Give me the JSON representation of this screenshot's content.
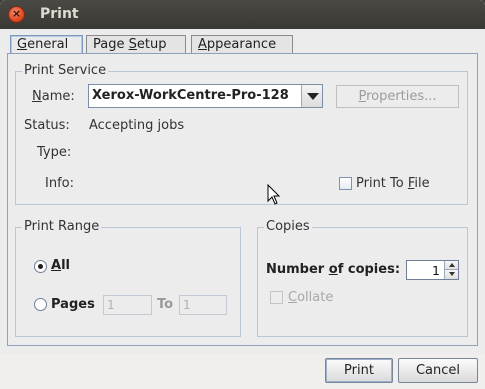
{
  "window": {
    "title": "Print"
  },
  "tabs": [
    {
      "label_underlined": "G",
      "label_rest": "eneral",
      "active": true
    },
    {
      "label_pre": "Page ",
      "label_underlined": "S",
      "label_rest": "etup",
      "active": false
    },
    {
      "label_underlined": "A",
      "label_rest": "ppearance",
      "active": false
    }
  ],
  "print_service": {
    "title": "Print Service",
    "name_label_u": "N",
    "name_label_rest": "ame:",
    "selected_printer": "Xerox-WorkCentre-Pro-128",
    "properties_u": "P",
    "properties_rest": "roperties...",
    "status_label": "Status:",
    "status_value": "Accepting jobs",
    "type_label": "Type:",
    "type_value": "",
    "info_label": "Info:",
    "info_value": "",
    "print_to_file_pre": "Print To ",
    "print_to_file_u": "F",
    "print_to_file_rest": "ile",
    "print_to_file_checked": false
  },
  "print_range": {
    "title": "Print Range",
    "all_u": "A",
    "all_rest": "ll",
    "all_selected": true,
    "pages_pre": "Pa",
    "pages_u": "g",
    "pages_rest": "es",
    "pages_from": "1",
    "to_label": "To",
    "pages_to": "1"
  },
  "copies": {
    "title": "Copies",
    "number_pre": "Number ",
    "number_u": "o",
    "number_rest": "f copies:",
    "count": "1",
    "collate_u": "C",
    "collate_rest": "ollate",
    "collate_checked": false
  },
  "footer": {
    "print_label": "Print",
    "cancel_label": "Cancel"
  }
}
